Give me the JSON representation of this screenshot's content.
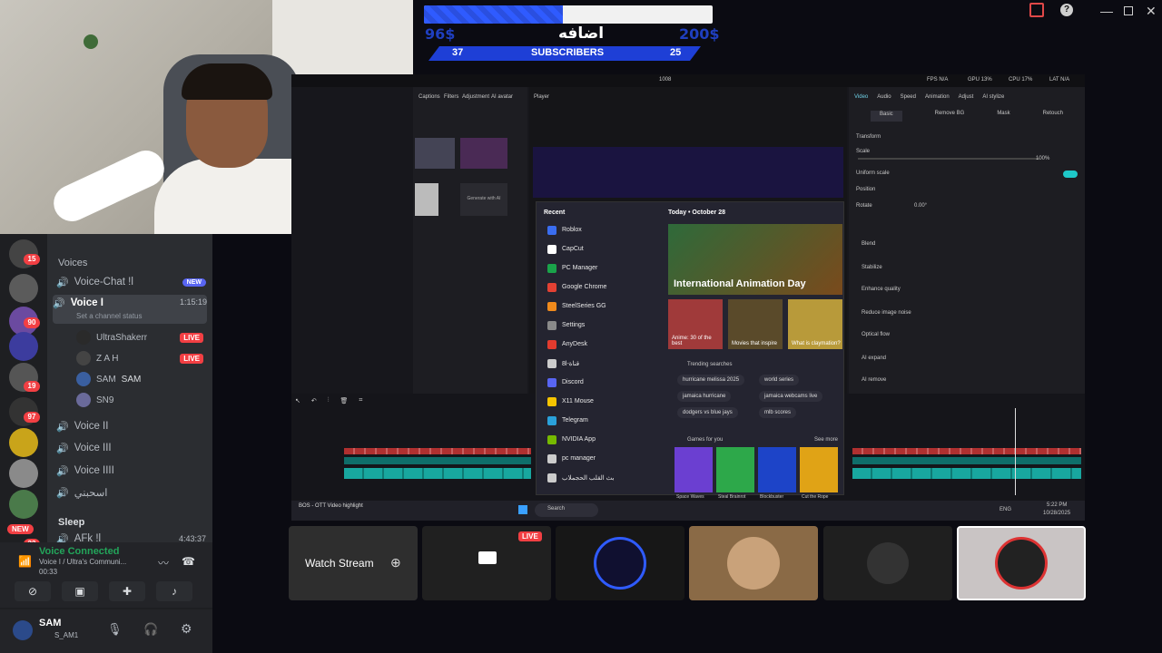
{
  "overlay": {
    "goal_left": "96$",
    "goal_right": "200$",
    "goal_label": "اضافه",
    "goal_progress": 0.48,
    "subs_left": "37",
    "subs_label": "SUBSCRIBERS",
    "subs_right": "25"
  },
  "discord": {
    "category_voices": "Voices",
    "channels": [
      {
        "name": "Voice-Chat !l",
        "badge": "NEW"
      },
      {
        "name": "Voice I",
        "time": "1:15:19",
        "status": "Set a channel status",
        "active": true
      },
      {
        "name": "Voice II"
      },
      {
        "name": "Voice III"
      },
      {
        "name": "Voice IIII"
      },
      {
        "name": "اسحبني"
      }
    ],
    "users": [
      {
        "name": "UltraShakerr",
        "live": "LIVE"
      },
      {
        "name": "Z A H",
        "live": "LIVE"
      },
      {
        "name": "SAM",
        "tag": "SAM"
      },
      {
        "name": "SN9"
      }
    ],
    "category_sleep": "Sleep",
    "sleep_channel": "AFk !l",
    "sleep_time": "4:43:37",
    "server_badges": [
      "15",
      "90",
      "19",
      "97",
      "33"
    ],
    "new_pill": "NEW",
    "voice_connected": "Voice Connected",
    "voice_sub": "Voice I / Ultra's Communi...",
    "voice_timer": "00:33",
    "user_name": "SAM",
    "user_tag": "S_AM1"
  },
  "editor": {
    "width_label": "1008",
    "player_label": "Player",
    "top_stats": [
      "FPS N/A",
      "GPU 13%",
      "CPU 17%",
      "LAT N/A"
    ],
    "right_tabs": [
      "Video",
      "Audio",
      "Speed",
      "Animation",
      "Adjust",
      "AI stylize"
    ],
    "sub_tabs": [
      "Basic",
      "Remove BG",
      "Mask",
      "Retouch"
    ],
    "props": [
      "Transform",
      "Scale",
      "Uniform scale",
      "Position",
      "Rotate",
      "Blend",
      "Stabilize",
      "Enhance quality",
      "Reduce image noise",
      "Optical flow",
      "AI expand",
      "AI remove"
    ],
    "scale_value": "100%",
    "rotate_value": "0.00°",
    "media_tabs": [
      "Captions",
      "Filters",
      "Adjustment",
      "AI avatar"
    ],
    "clip_caption": "Generate with AI",
    "status_bar": "BOS - OTT Video highlight"
  },
  "startmenu": {
    "recent_label": "Recent",
    "apps": [
      {
        "name": "Roblox",
        "color": "#3a6df0"
      },
      {
        "name": "CapCut",
        "color": "#ffffff"
      },
      {
        "name": "PC Manager",
        "color": "#1aa34a"
      },
      {
        "name": "Google Chrome",
        "color": "#e34133"
      },
      {
        "name": "SteelSeries GG",
        "color": "#f08a1c"
      },
      {
        "name": "Settings",
        "color": "#8a8a8a"
      },
      {
        "name": "AnyDesk",
        "color": "#e33b2e"
      },
      {
        "name": "8l-قناة",
        "color": "#cccccc"
      },
      {
        "name": "Discord",
        "color": "#5865f2"
      },
      {
        "name": "X11 Mouse",
        "color": "#f5c400"
      },
      {
        "name": "Telegram",
        "color": "#2aa1da"
      },
      {
        "name": "NVIDIA App",
        "color": "#76b900"
      },
      {
        "name": "pc manager",
        "color": "#cccccc"
      },
      {
        "name": "بث القلب الحجملاب",
        "color": "#cccccc"
      }
    ],
    "today": "Today • October 28",
    "hero": "International Animation Day",
    "cards": [
      "Anime: 30 of the best",
      "Movies that inspire",
      "What is claymation?"
    ],
    "trending_label": "Trending searches",
    "trending": [
      "hurricane melissa 2025",
      "world series",
      "jamaica hurricane",
      "jamaica webcams live",
      "dodgers vs blue jays",
      "mlb scores"
    ],
    "games_label": "Games for you",
    "see_more": "See more",
    "games": [
      "Space Waves",
      "Steal Brainrot",
      "Blockbuster",
      "Cut the Rope"
    ],
    "game_colors": [
      "#6b3fd1",
      "#2da84a",
      "#1d44c8",
      "#e0a316"
    ]
  },
  "taskbar": {
    "search": "Search",
    "lang": "ENG",
    "time": "5:22 PM",
    "date": "10/28/2025"
  },
  "tiles": {
    "watch_stream": "Watch Stream",
    "live": "LIVE"
  }
}
